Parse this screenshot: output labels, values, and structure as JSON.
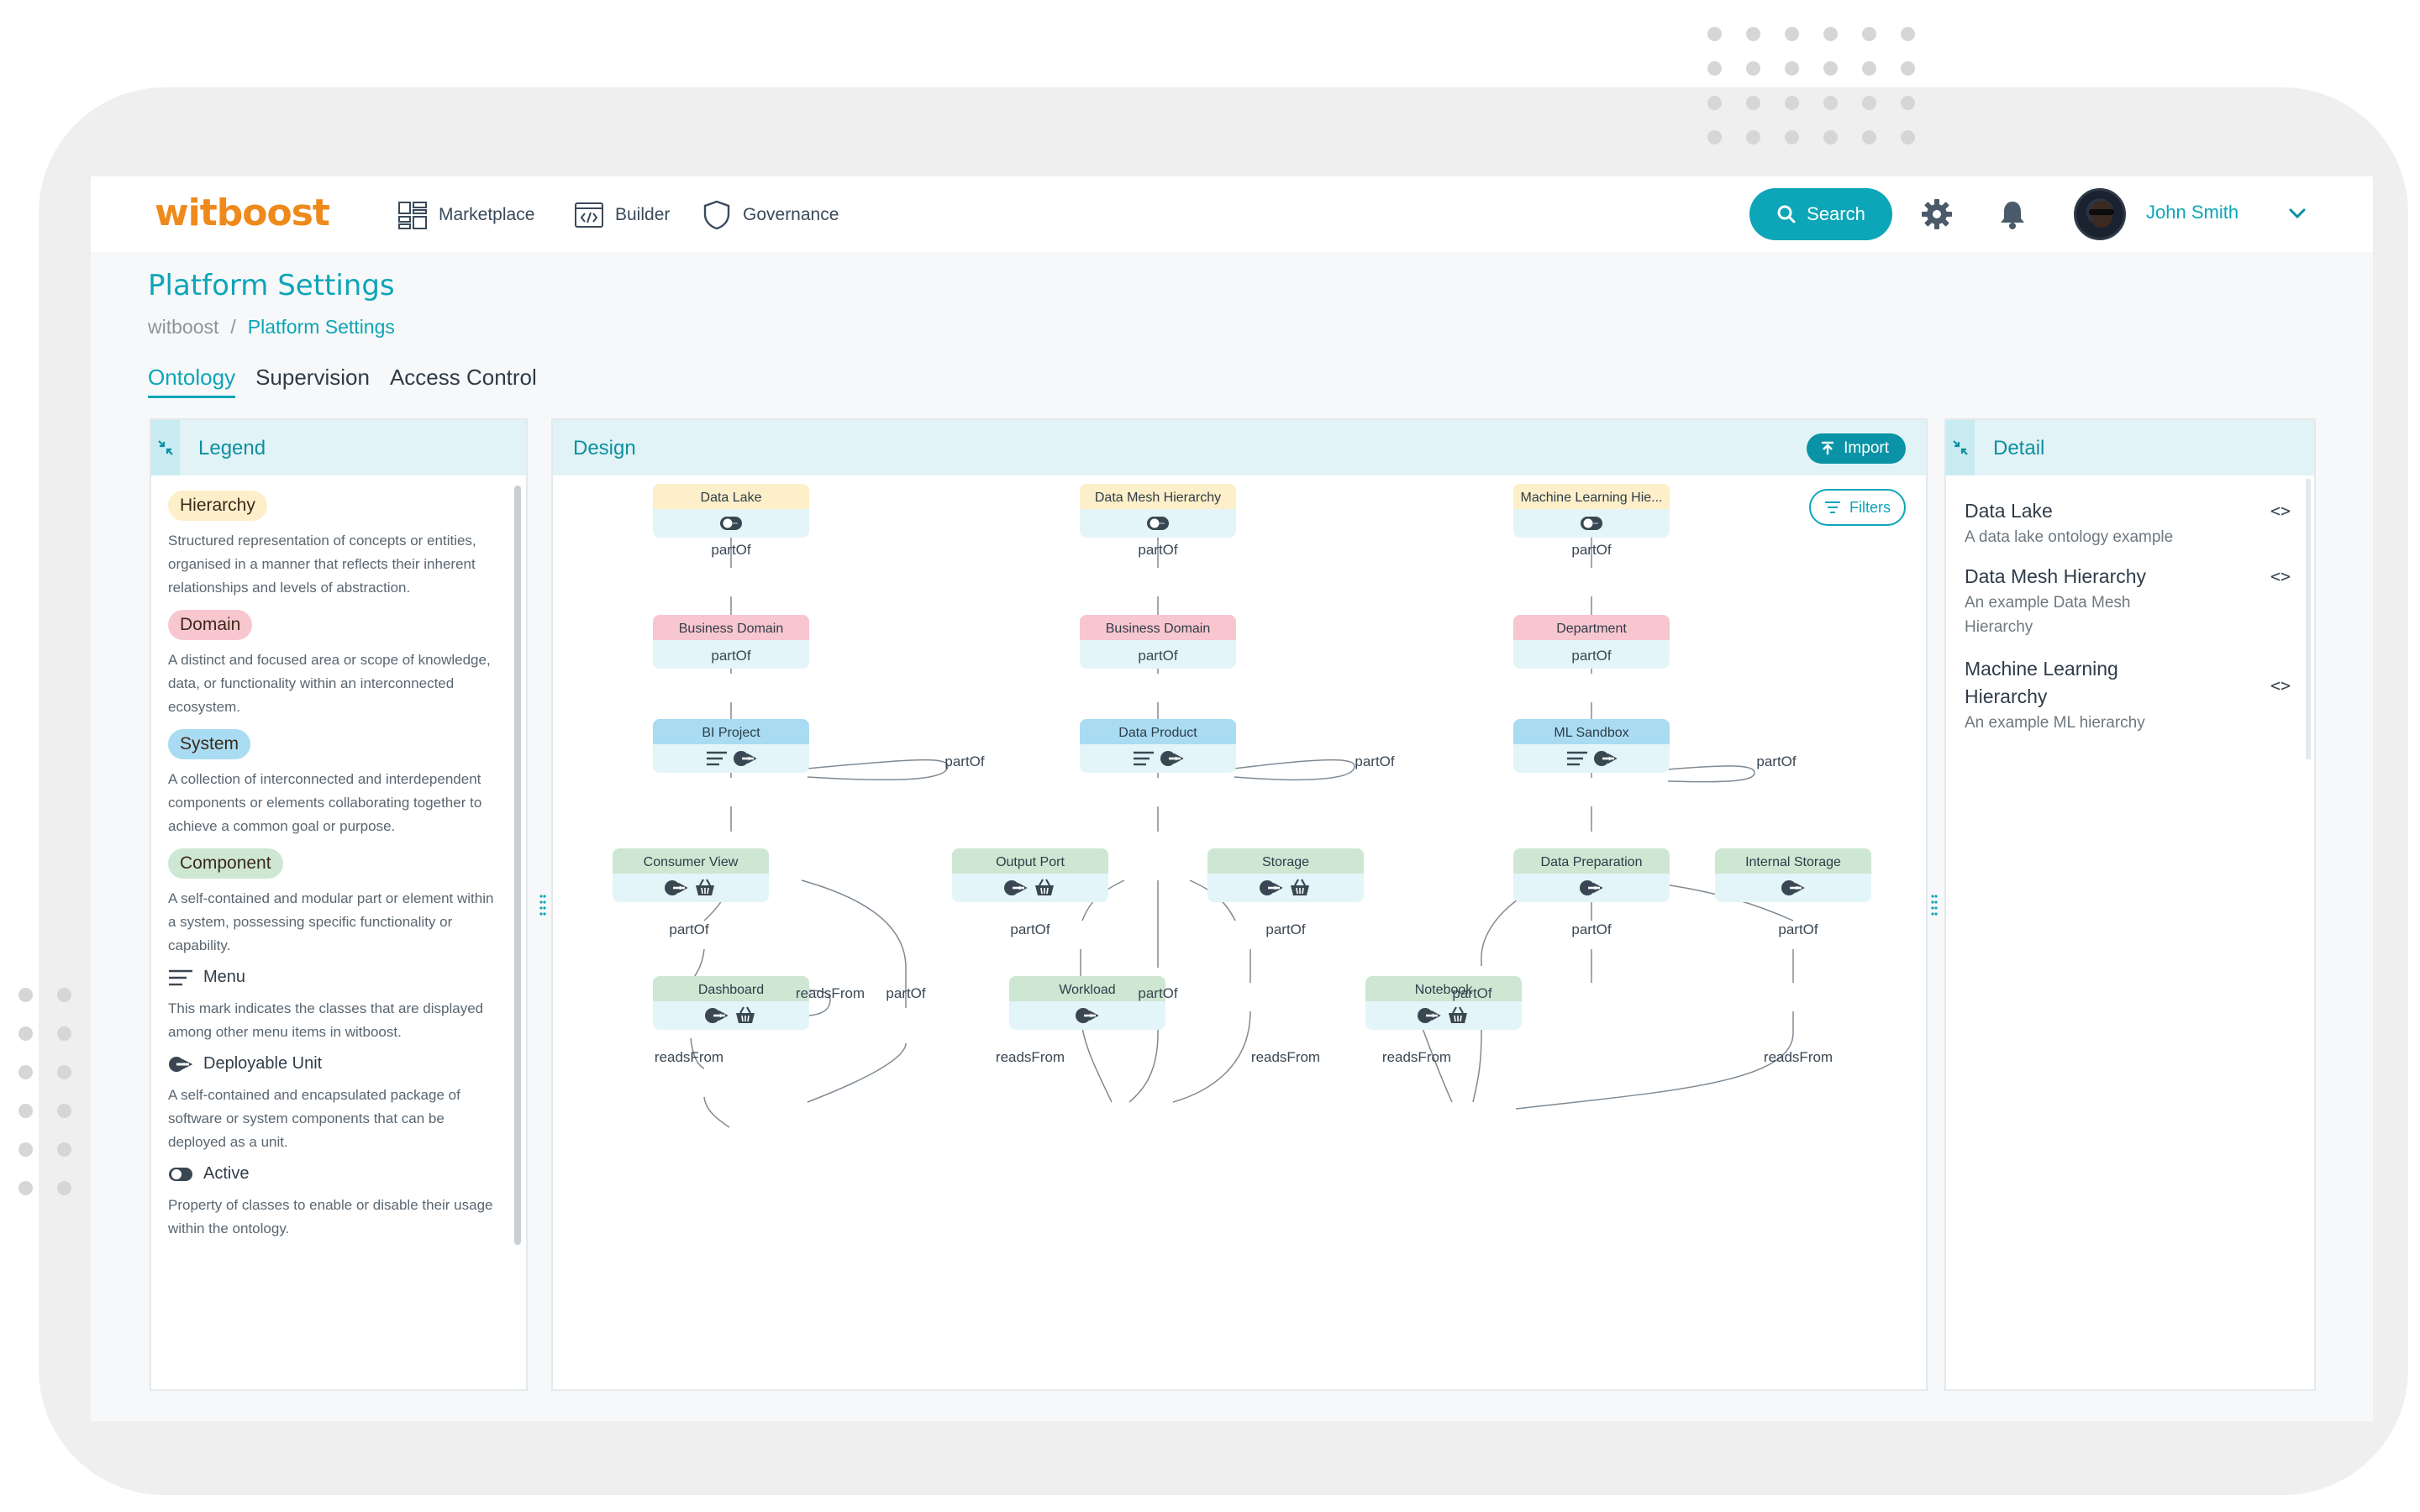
{
  "app": {
    "logo": "witboost",
    "nav": [
      {
        "label": "Marketplace",
        "icon": "grid-icon"
      },
      {
        "label": "Builder",
        "icon": "code-window-icon"
      },
      {
        "label": "Governance",
        "icon": "shield-icon"
      }
    ],
    "search_label": "Search",
    "user_name": "John Smith"
  },
  "page": {
    "title": "Platform Settings",
    "breadcrumb": [
      "witboost",
      "/",
      "Platform Settings"
    ],
    "tabs": [
      "Ontology",
      "Supervision",
      "Access Control"
    ],
    "active_tab": "Ontology"
  },
  "legend": {
    "title": "Legend",
    "items": [
      {
        "chip": "Hierarchy",
        "color": "#fcefc9",
        "desc": "Structured representation of concepts or entities, organised in a manner that reflects their inherent relationships and levels of abstraction."
      },
      {
        "chip": "Domain",
        "color": "#f8c6cf",
        "desc": "A distinct and focused area or scope of knowledge, data, or functionality within an interconnected ecosystem."
      },
      {
        "chip": "System",
        "color": "#a9dcf3",
        "desc": "A collection of interconnected and interdependent components or elements collaborating together to achieve a common goal or purpose."
      },
      {
        "chip": "Component",
        "color": "#cde7d3",
        "desc": "A self-contained and modular part or element within a system, possessing specific functionality or capability."
      }
    ],
    "marks": [
      {
        "label": "Menu",
        "icon": "menu-lines-icon",
        "desc": "This mark indicates the classes that are displayed among other menu items in witboost."
      },
      {
        "label": "Deployable Unit",
        "icon": "deploy-icon",
        "desc": "A self-contained and encapsulated package of software or system components that can be deployed as a unit."
      },
      {
        "label": "Active",
        "icon": "toggle-icon",
        "desc": "Property of classes to enable or disable their usage within the ontology."
      }
    ]
  },
  "design": {
    "title": "Design",
    "import_label": "Import",
    "filters_label": "Filters",
    "edge_labels": {
      "partOf": "partOf",
      "readsFrom": "readsFrom"
    },
    "hierarchies": [
      {
        "root": "Data Lake",
        "domain": "Business Domain",
        "system": "BI Project",
        "components": [
          "Consumer View",
          "Dashboard"
        ]
      },
      {
        "root": "Data Mesh Hierarchy",
        "domain": "Business Domain",
        "system": "Data Product",
        "components": [
          "Output Port",
          "Storage",
          "Workload"
        ]
      },
      {
        "root": "Machine Learning Hie...",
        "domain": "Department",
        "system": "ML Sandbox",
        "components": [
          "Data Preparation",
          "Internal Storage",
          "Notebook"
        ]
      }
    ]
  },
  "detail": {
    "title": "Detail",
    "items": [
      {
        "name": "Data Lake",
        "desc": "A data lake ontology example"
      },
      {
        "name": "Data Mesh Hierarchy",
        "desc": "An example Data Mesh Hierarchy"
      },
      {
        "name": "Machine Learning Hierarchy",
        "desc": "An example ML hierarchy"
      }
    ]
  },
  "colors": {
    "accent": "#0da5b8",
    "hierarchy": "#fcefc9",
    "domain": "#f8c6cf",
    "system": "#a9dcf3",
    "component": "#cde7d3",
    "logo": "#ee8a1c"
  }
}
